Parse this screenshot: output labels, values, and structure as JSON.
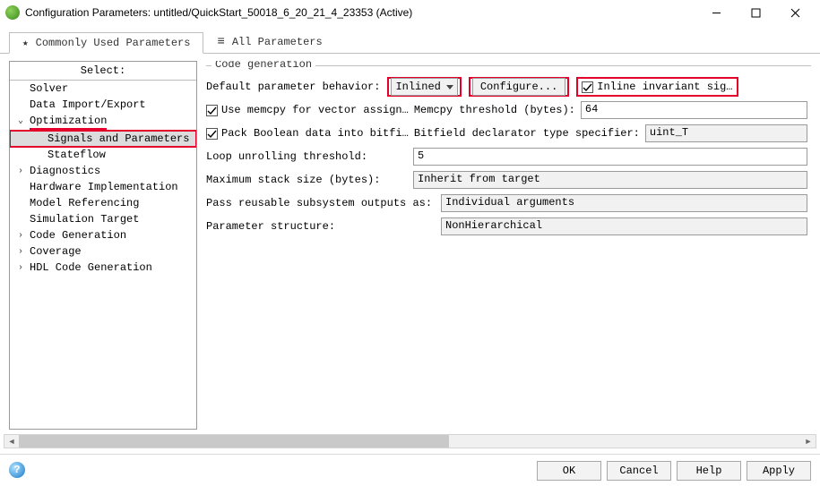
{
  "titlebar": {
    "title": "Configuration Parameters: untitled/QuickStart_50018_6_20_21_4_23353 (Active)"
  },
  "tabs": {
    "common": "Commonly Used Parameters",
    "all": "All Parameters"
  },
  "nav": {
    "header": "Select:",
    "solver": "Solver",
    "data_import": "Data Import/Export",
    "optimization": "Optimization",
    "signals_params": "Signals and Parameters",
    "stateflow": "Stateflow",
    "diagnostics": "Diagnostics",
    "hw_impl": "Hardware Implementation",
    "model_ref": "Model Referencing",
    "sim_target": "Simulation Target",
    "code_gen": "Code Generation",
    "coverage": "Coverage",
    "hdl_code_gen": "HDL Code Generation"
  },
  "form": {
    "section_title": "Code generation",
    "def_param_behavior_label": "Default parameter behavior:",
    "def_param_behavior_value": "Inlined",
    "configure_btn": "Configure...",
    "inline_invariant": "Inline invariant sig…",
    "use_memcpy": "Use memcpy for vector assign…",
    "memcpy_threshold_label": "Memcpy threshold (bytes):",
    "memcpy_threshold_value": "64",
    "pack_boolean": "Pack Boolean data into bitfi…",
    "bitfield_label": "Bitfield declarator type specifier:",
    "bitfield_value": "uint_T",
    "loop_unroll_label": "Loop unrolling threshold:",
    "loop_unroll_value": "5",
    "max_stack_label": "Maximum stack size (bytes):",
    "max_stack_value": "Inherit from target",
    "pass_reusable_label": "Pass reusable subsystem outputs as:",
    "pass_reusable_value": "Individual arguments",
    "param_struct_label": "Parameter structure:",
    "param_struct_value": "NonHierarchical"
  },
  "buttons": {
    "ok": "OK",
    "cancel": "Cancel",
    "help": "Help",
    "apply": "Apply"
  }
}
